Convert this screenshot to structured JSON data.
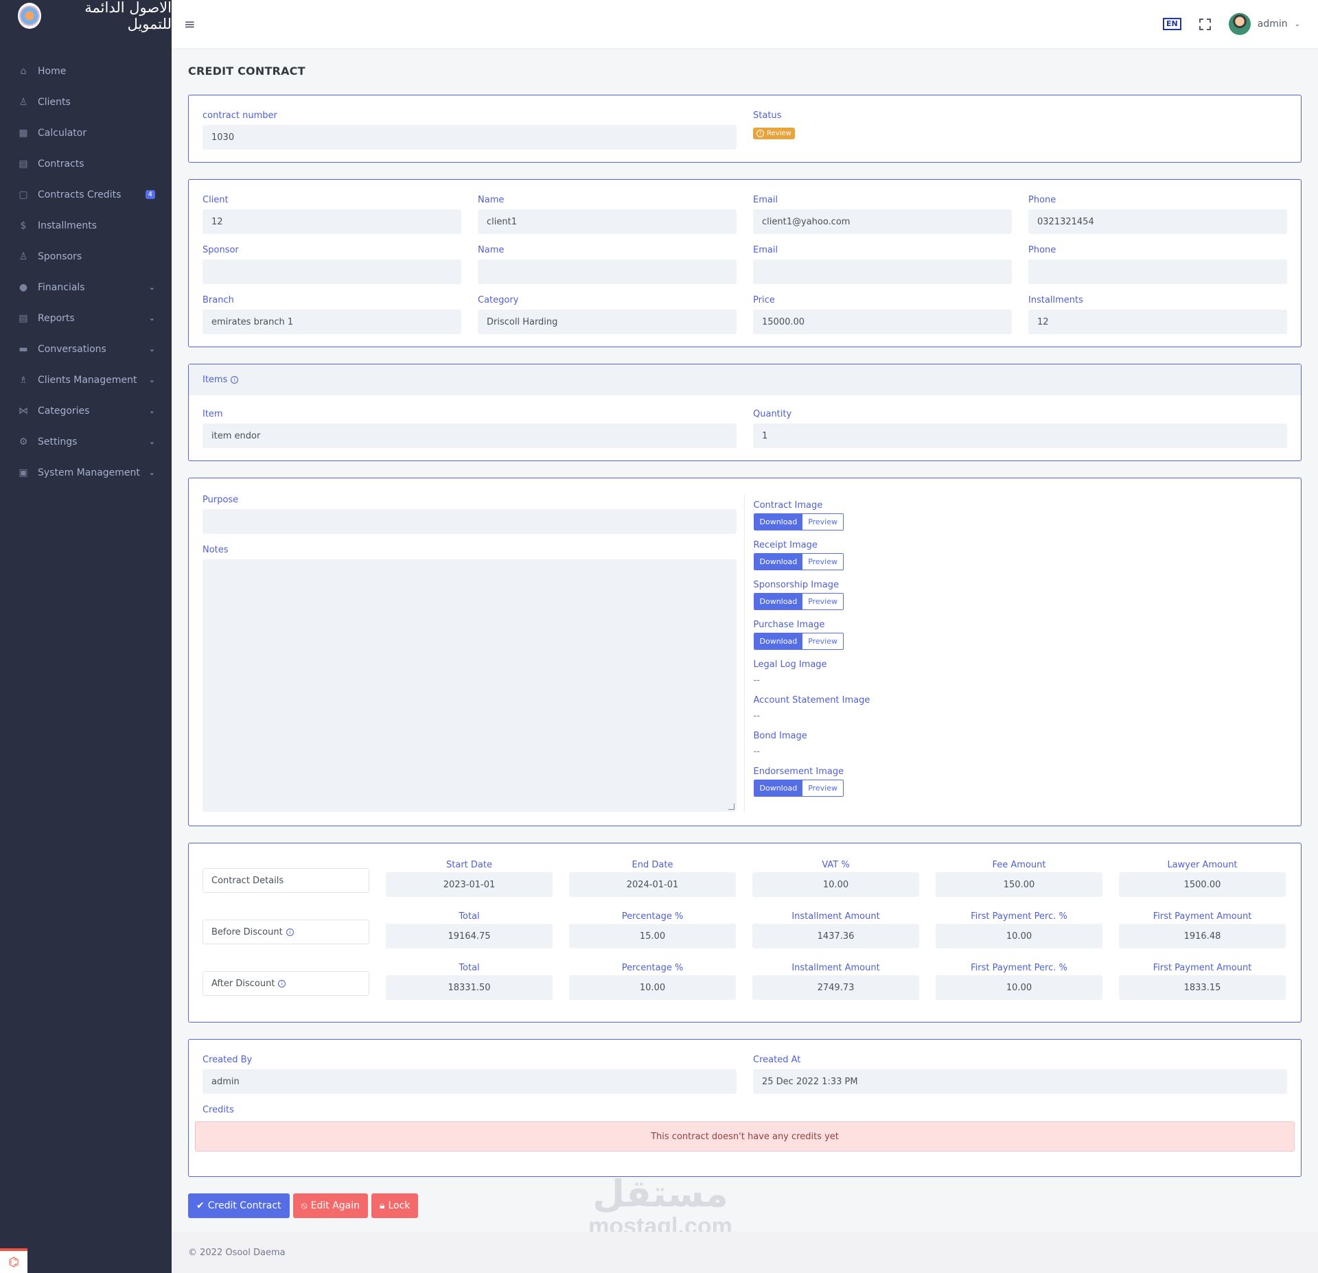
{
  "brand": {
    "name": "الاصول الدائمة للتمويل"
  },
  "sidebar": {
    "items": [
      {
        "label": "Home",
        "icon": "home-icon",
        "glyph": "⌂"
      },
      {
        "label": "Clients",
        "icon": "user-icon",
        "glyph": "♙"
      },
      {
        "label": "Calculator",
        "icon": "calculator-icon",
        "glyph": "▦"
      },
      {
        "label": "Contracts",
        "icon": "document-icon",
        "glyph": "▤"
      },
      {
        "label": "Contracts Credits",
        "icon": "document-search-icon",
        "glyph": "▢",
        "badge": "4"
      },
      {
        "label": "Installments",
        "icon": "dollar-icon",
        "glyph": "$"
      },
      {
        "label": "Sponsors",
        "icon": "user-voice-icon",
        "glyph": "♙"
      },
      {
        "label": "Financials",
        "icon": "coin-icon",
        "glyph": "●",
        "chevron": "⌄"
      },
      {
        "label": "Reports",
        "icon": "report-icon",
        "glyph": "▤",
        "chevron": "⌄"
      },
      {
        "label": "Conversations",
        "icon": "chat-icon",
        "glyph": "▬",
        "chevron": "⌄"
      },
      {
        "label": "Clients Management",
        "icon": "users-icon",
        "glyph": "♗",
        "chevron": "⌄"
      },
      {
        "label": "Categories",
        "icon": "share-icon",
        "glyph": "⋈",
        "chevron": "⌄"
      },
      {
        "label": "Settings",
        "icon": "gear-icon",
        "glyph": "⚙",
        "chevron": "⌄"
      },
      {
        "label": "System Management",
        "icon": "id-card-icon",
        "glyph": "▣",
        "chevron": "⌄"
      }
    ]
  },
  "header": {
    "hamburger": "≡",
    "language": "EN",
    "user": "admin",
    "user_chevron": "⌄"
  },
  "page": {
    "title": "CREDIT CONTRACT"
  },
  "contract": {
    "number_label": "contract number",
    "number": "1030",
    "status_label": "Status",
    "status": "Review",
    "status_icon": "!"
  },
  "client": {
    "client_label": "Client",
    "client": "12",
    "name_label": "Name",
    "name": "client1",
    "email_label": "Email",
    "email": "client1@yahoo.com",
    "phone_label": "Phone",
    "phone": "0321321454"
  },
  "sponsor": {
    "sponsor_label": "Sponsor",
    "sponsor": "",
    "name_label": "Name",
    "name": "",
    "email_label": "Email",
    "email": "",
    "phone_label": "Phone",
    "phone": ""
  },
  "details": {
    "branch_label": "Branch",
    "branch": "emirates branch 1",
    "category_label": "Category",
    "category": "Driscoll Harding",
    "price_label": "Price",
    "price": "15000.00",
    "installments_label": "Installments",
    "installments": "12"
  },
  "items": {
    "title": "Items",
    "item_label": "Item",
    "item": "item endor",
    "quantity_label": "Quantity",
    "quantity": "1"
  },
  "purpose": {
    "label": "Purpose",
    "value": ""
  },
  "notes": {
    "label": "Notes",
    "value": ""
  },
  "images": {
    "download": "Download",
    "preview": "Preview",
    "empty": "--",
    "contract": "Contract Image",
    "receipt": "Receipt Image",
    "sponsorship": "Sponsorship Image",
    "purchase": "Purchase Image",
    "legal_log": "Legal Log Image",
    "account_statement": "Account Statement Image",
    "bond": "Bond Image",
    "endorsement": "Endorsement Image"
  },
  "financial": {
    "contract_details": {
      "label": "Contract Details",
      "headers": [
        "Start Date",
        "End Date",
        "VAT %",
        "Fee Amount",
        "Lawyer Amount"
      ],
      "values": [
        "2023-01-01",
        "2024-01-01",
        "10.00",
        "150.00",
        "1500.00"
      ]
    },
    "before_discount": {
      "label": "Before Discount",
      "headers": [
        "Total",
        "Percentage %",
        "Installment Amount",
        "First Payment Perc. %",
        "First Payment Amount"
      ],
      "values": [
        "19164.75",
        "15.00",
        "1437.36",
        "10.00",
        "1916.48"
      ]
    },
    "after_discount": {
      "label": "After Discount",
      "headers": [
        "Total",
        "Percentage %",
        "Installment Amount",
        "First Payment Perc. %",
        "First Payment Amount"
      ],
      "values": [
        "18331.50",
        "10.00",
        "2749.73",
        "10.00",
        "1833.15"
      ]
    }
  },
  "meta": {
    "created_by_label": "Created By",
    "created_by": "admin",
    "created_at_label": "Created At",
    "created_at": "25 Dec 2022 1:33 PM",
    "credits_label": "Credits",
    "no_credits": "This contract doesn't have any credits yet"
  },
  "actions": {
    "credit_contract": "Credit Contract",
    "edit_again": "Edit Again",
    "lock": "Lock"
  },
  "footer": {
    "text": "© 2022 Osool Daema"
  },
  "watermark": {
    "arabic": "مستقل",
    "latin": "mostaql.com"
  },
  "colors": {
    "primary": "#556ee6",
    "sidebar": "#2a3042",
    "warning": "#e8a33d",
    "danger": "#f46a6a"
  }
}
